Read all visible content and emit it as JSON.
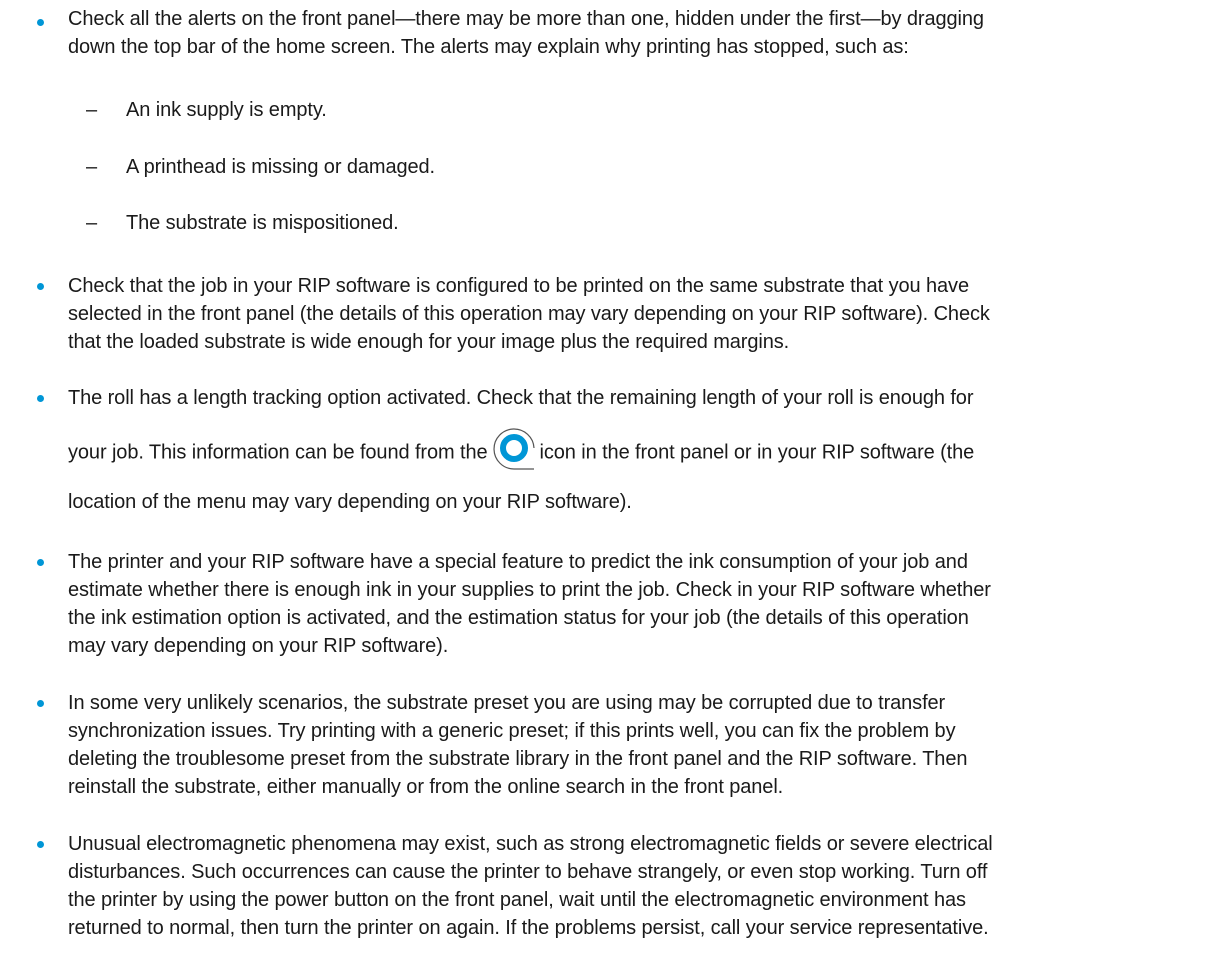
{
  "bullets": [
    {
      "lines": [
        "Check all the alerts on the front panel—there may be more than one, hidden under the first—by dragging",
        "down the top bar of the home screen. The alerts may explain why printing has stopped, such as:"
      ],
      "subitems": [
        {
          "dash": "–",
          "text": "An ink supply is empty."
        },
        {
          "dash": "–",
          "text": "A printhead is missing or damaged."
        },
        {
          "dash": "–",
          "text": "The substrate is mispositioned."
        }
      ]
    },
    {
      "lines": [
        "Check that the job in your RIP software is configured to be printed on the same substrate that you have",
        "selected in the front panel (the details of this operation may vary depending on your RIP software). Check",
        "that the loaded substrate is wide enough for your image plus the required margins."
      ]
    },
    {
      "line1": "The roll has a length tracking option activated. Check that the remaining length of your roll is enough for",
      "line2_before": "your job. This information can be found from the",
      "line2_after": "icon in the front panel or in your RIP software (the",
      "line3": "location of the menu may vary depending on your RIP software).",
      "icon": "roll-icon",
      "icon_color": "#0096d6"
    },
    {
      "lines": [
        "The printer and your RIP software have a special feature to predict the ink consumption of your job and",
        "estimate whether there is enough ink in your supplies to print the job. Check in your RIP software whether",
        "the ink estimation option is activated, and the estimation status for your job (the details of this operation",
        "may vary depending on your RIP software)."
      ]
    },
    {
      "lines": [
        "In some very unlikely scenarios, the substrate preset you are using may be corrupted due to transfer",
        "synchronization issues. Try printing with a generic preset; if this prints well, you can fix the problem by",
        "deleting the troublesome preset from the substrate library in the front panel and the RIP software. Then",
        "reinstall the substrate, either manually or from the online search in the front panel."
      ]
    },
    {
      "lines": [
        "Unusual electromagnetic phenomena may exist, such as strong electromagnetic fields or severe electrical",
        "disturbances. Such occurrences can cause the printer to behave strangely, or even stop working. Turn off",
        "the printer by using the power button on the front panel, wait until the electromagnetic environment has",
        "returned to normal, then turn the printer on again. If the problems persist, call your service representative."
      ]
    }
  ],
  "colors": {
    "bullet": "#0096d6",
    "text": "#1a1a1a"
  }
}
